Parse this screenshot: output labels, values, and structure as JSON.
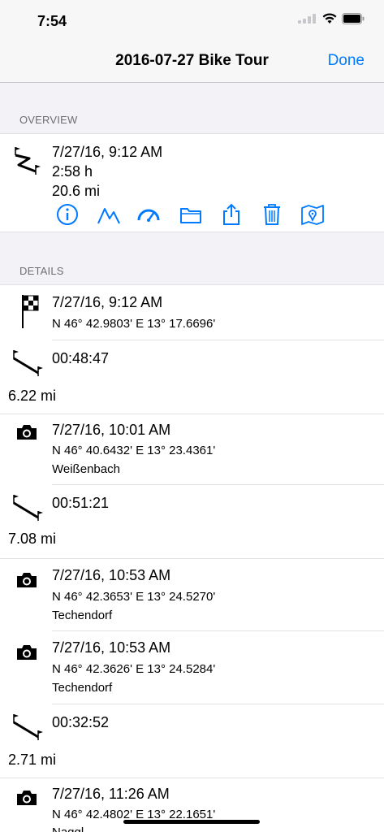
{
  "status": {
    "time": "7:54"
  },
  "nav": {
    "title": "2016-07-27 Bike Tour",
    "done_label": "Done"
  },
  "overview": {
    "header": "OVERVIEW",
    "start": "7/27/16, 9:12 AM",
    "duration": "2:58 h",
    "distance": "20.6 mi",
    "actions": [
      "info-icon",
      "elevation-icon",
      "speedometer-icon",
      "folder-icon",
      "share-icon",
      "trash-icon",
      "map-icon"
    ]
  },
  "details": {
    "header": "DETAILS",
    "start_row": {
      "time": "7/27/16, 9:12 AM",
      "coords": "N 46° 42.9803' E 13° 17.6696'"
    },
    "seg1": {
      "duration": "00:48:47",
      "distance": "6.22 mi"
    },
    "photo1": {
      "time": "7/27/16, 10:01 AM",
      "coords": "N 46° 40.6432' E 13° 23.4361'",
      "place": "Weißenbach"
    },
    "seg2": {
      "duration": "00:51:21",
      "distance": "7.08 mi"
    },
    "photo2": {
      "time": "7/27/16, 10:53 AM",
      "coords": "N 46° 42.3653' E 13° 24.5270'",
      "place": "Techendorf"
    },
    "photo3": {
      "time": "7/27/16, 10:53 AM",
      "coords": "N 46° 42.3626' E 13° 24.5284'",
      "place": "Techendorf"
    },
    "seg3": {
      "duration": "00:32:52",
      "distance": "2.71 mi"
    },
    "photo4": {
      "time": "7/27/16, 11:26 AM",
      "coords": "N 46° 42.4802' E 13° 22.1651'",
      "place": "Naggl"
    }
  },
  "colors": {
    "accent": "#007aff",
    "background": "#f2f2f7"
  }
}
